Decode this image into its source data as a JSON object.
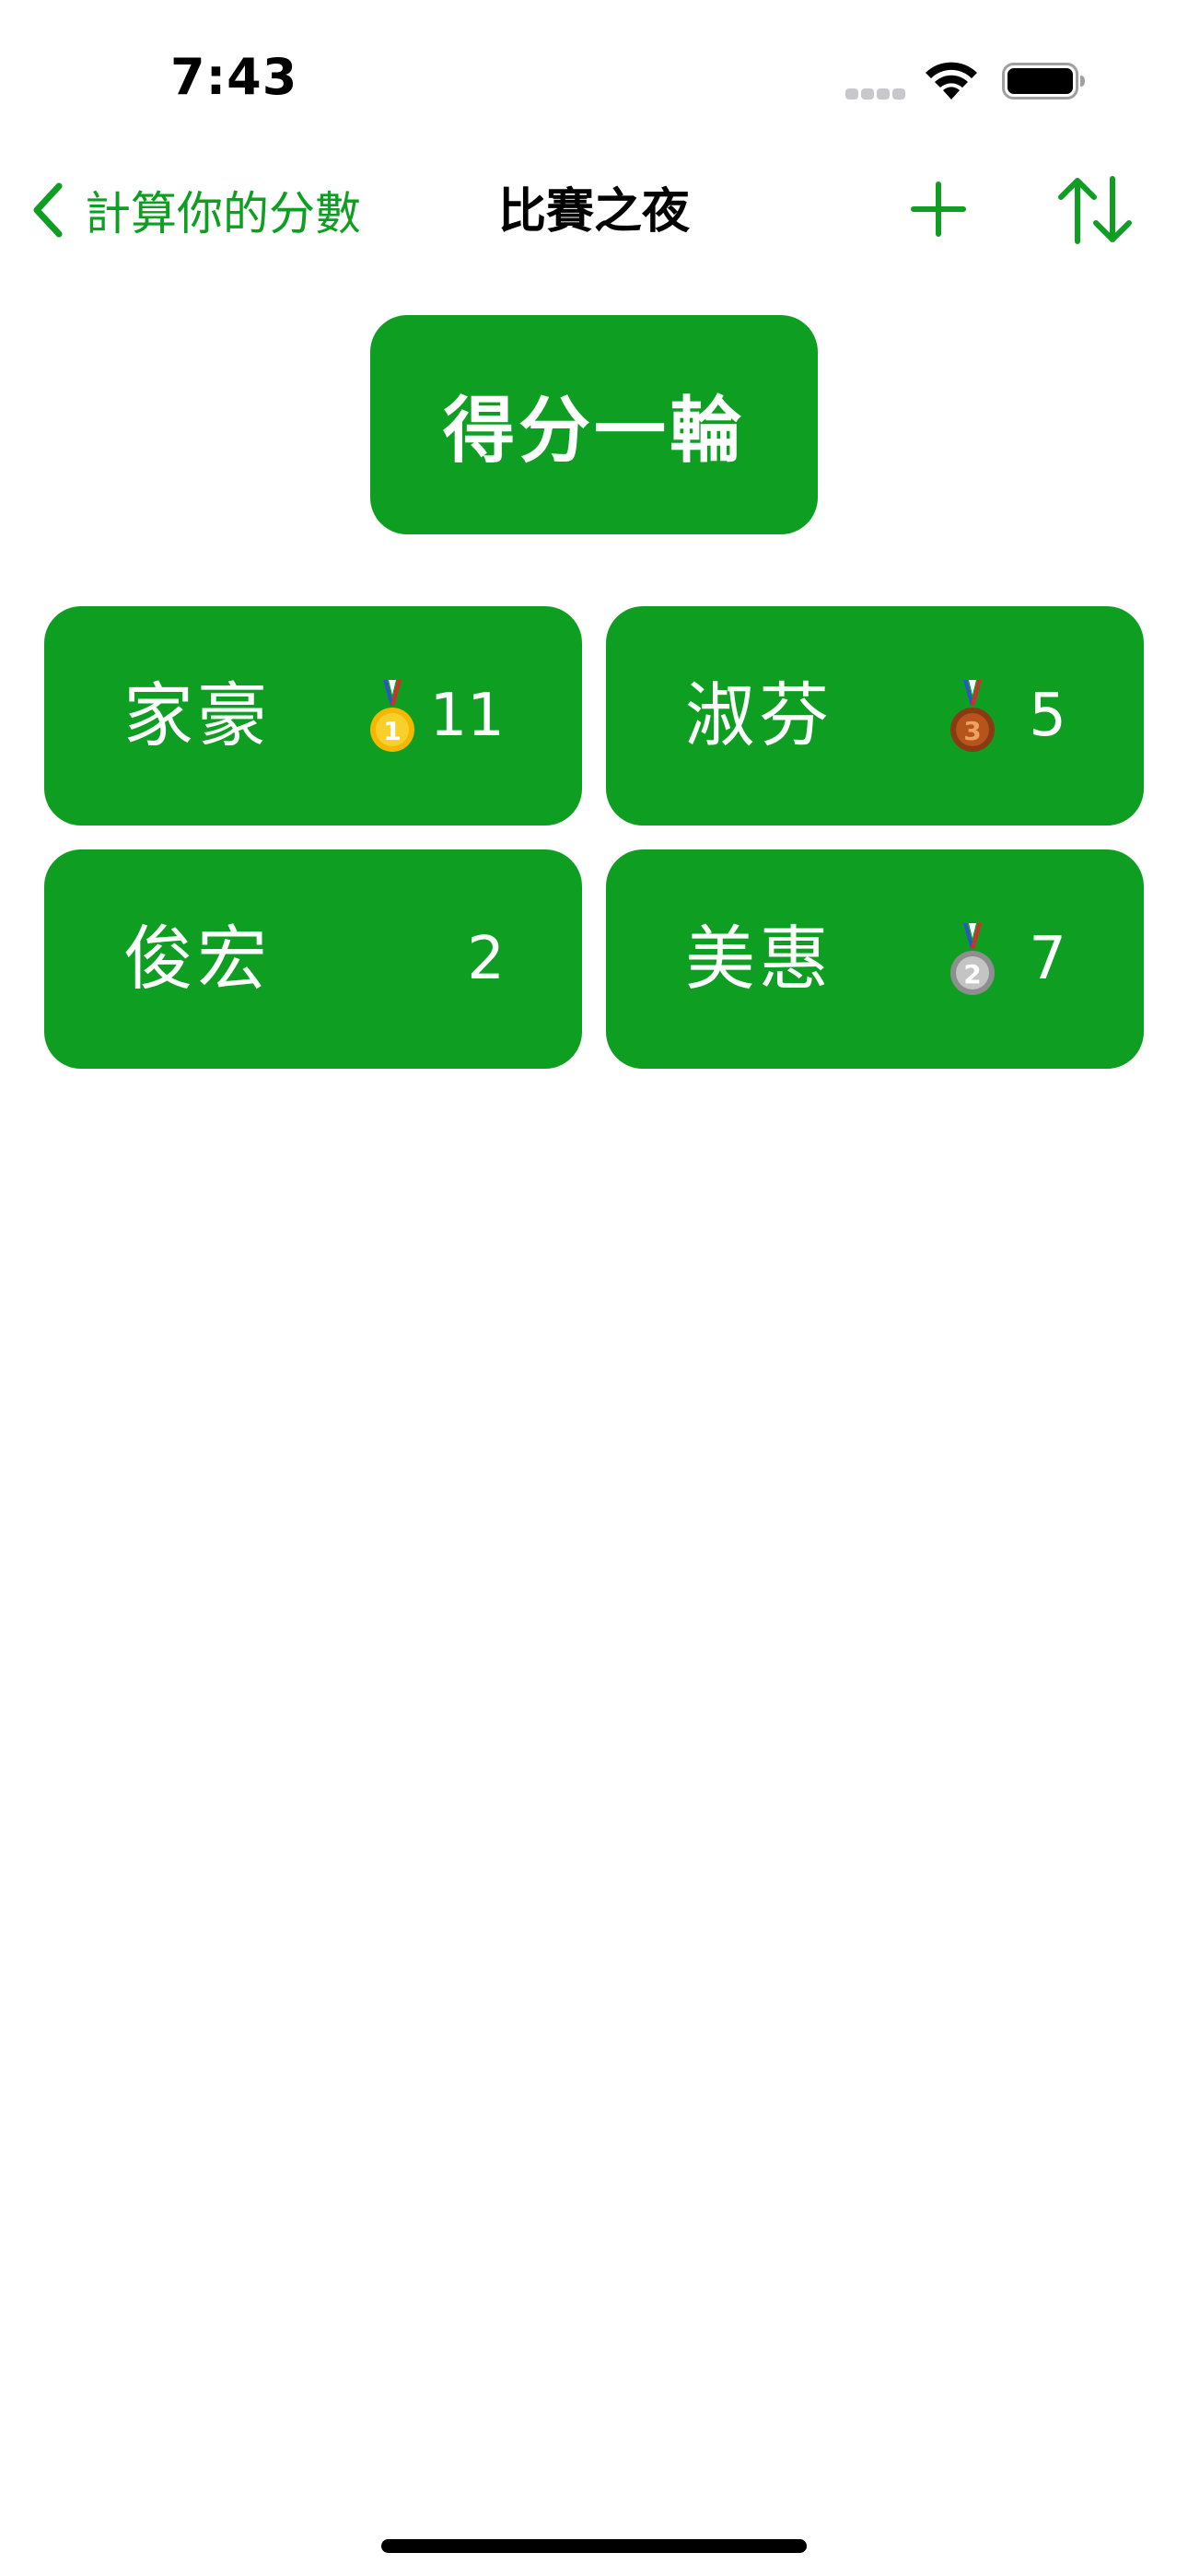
{
  "status_bar": {
    "time": "7:43"
  },
  "nav": {
    "back_label": "計算你的分數",
    "title": "比賽之夜",
    "icons": {
      "back": "chevron-left-icon",
      "add": "plus-icon",
      "sort": "sort-arrows-icon"
    }
  },
  "score_round_button": {
    "label": "得分一輪"
  },
  "players": [
    {
      "name": "家豪",
      "score": "11",
      "medal": "gold-1"
    },
    {
      "name": "淑芬",
      "score": "5",
      "medal": "bronze-3"
    },
    {
      "name": "俊宏",
      "score": "2",
      "medal": null
    },
    {
      "name": "美惠",
      "score": "7",
      "medal": "silver-2"
    }
  ],
  "colors": {
    "accent": "#0d9e22",
    "card_text": "#ffffff",
    "gold": "#f5b800",
    "silver": "#a9a9a9",
    "bronze": "#b5541b"
  }
}
